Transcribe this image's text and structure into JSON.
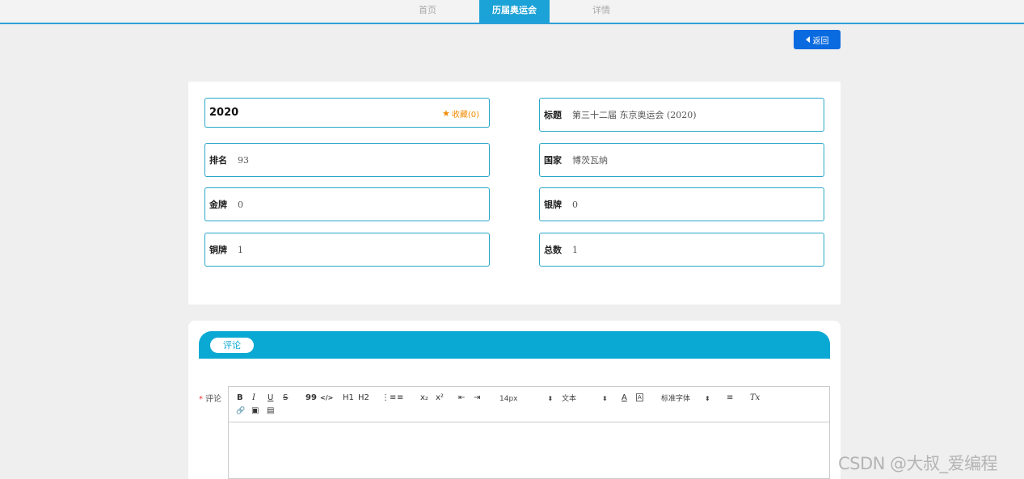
{
  "nav": {
    "home": "首页",
    "olympics": "历届奥运会",
    "detail": "详情"
  },
  "back_button": "返回",
  "detail": {
    "year": "2020",
    "favorite": "收藏(0)",
    "fields": {
      "title_label": "标题",
      "title_value": "第三十二届 东京奥运会 (2020)",
      "rank_label": "排名",
      "rank_value": "93",
      "country_label": "国家",
      "country_value": "博茨瓦纳",
      "gold_label": "金牌",
      "gold_value": "0",
      "silver_label": "银牌",
      "silver_value": "0",
      "bronze_label": "铜牌",
      "bronze_value": "1",
      "total_label": "总数",
      "total_value": "1"
    }
  },
  "comments": {
    "tab": "评论",
    "required": "*",
    "label": "评论",
    "toolbar": {
      "bold": "B",
      "italic": "I",
      "underline": "U",
      "strike": "S",
      "quote": "99",
      "code": "</>",
      "h1": "H1",
      "h2": "H2",
      "ol": "⋮≡",
      "ul": "≡",
      "sub": "x₂",
      "sup": "x²",
      "outdent": "⇤",
      "indent": "⇥",
      "size": "14px",
      "format": "文本",
      "color": "A",
      "bg": "A",
      "font": "标准字体",
      "align": "≡",
      "clear": "Tx",
      "link": "🔗",
      "image": "▣",
      "video": "▤"
    }
  },
  "watermark": "CSDN @大叔_爱编程",
  "colors": {
    "accent": "#1ba2d6",
    "back": "#0a6be0",
    "favorite": "#f08a00",
    "border": "#2aa7c9"
  }
}
